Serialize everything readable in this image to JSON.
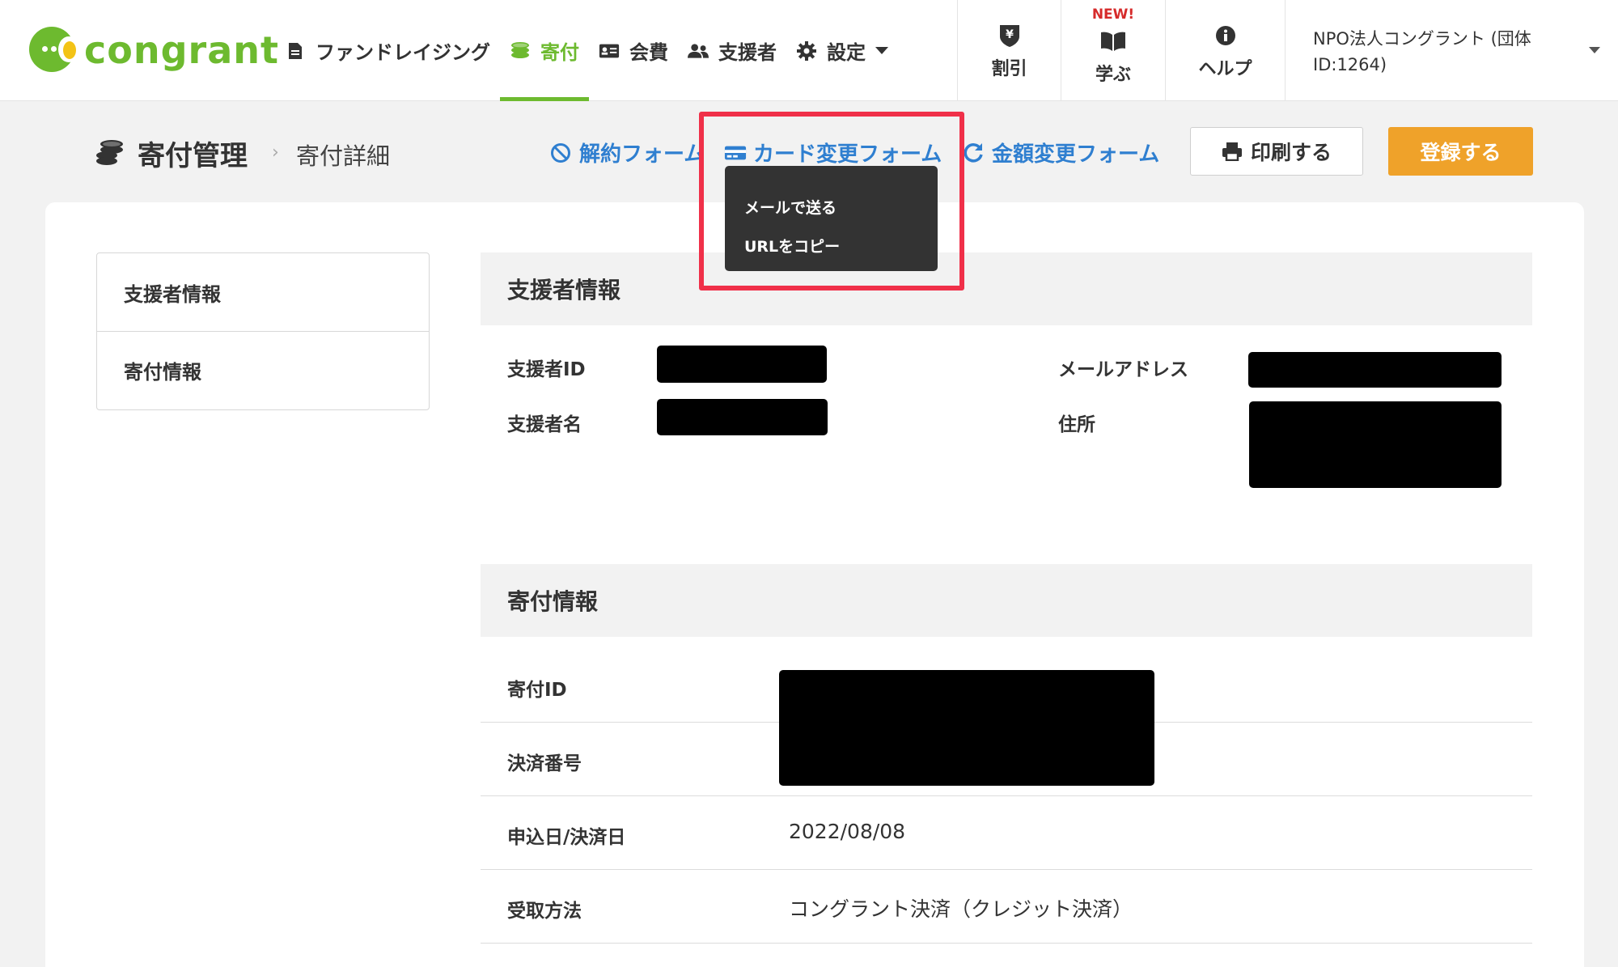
{
  "header": {
    "logo_text": "congrant",
    "nav": [
      {
        "label": "ファンドレイジング",
        "icon": "document-icon"
      },
      {
        "label": "寄付",
        "icon": "coins-icon",
        "active": true
      },
      {
        "label": "会費",
        "icon": "id-card-icon"
      },
      {
        "label": "支援者",
        "icon": "users-icon"
      },
      {
        "label": "設定",
        "icon": "gear-icon"
      }
    ],
    "util": {
      "discount_label": "割引",
      "learn_label": "学ぶ",
      "learn_badge": "NEW!",
      "help_label": "ヘルプ"
    },
    "org_line1": "NPO法人コングラント (団体",
    "org_line2": "ID:1264)"
  },
  "subheader": {
    "title": "寄付管理",
    "breadcrumb_sep": "›",
    "breadcrumb": "寄付詳細",
    "cancel_form": "解約フォーム",
    "card_change_form": "カード変更フォーム",
    "amount_change_form": "金額変更フォーム",
    "print_button": "印刷する",
    "register_button": "登録する"
  },
  "dropdown": {
    "items": [
      "メールで送る",
      "URLをコピー"
    ]
  },
  "sidemenu": {
    "items": [
      "支援者情報",
      "寄付情報"
    ]
  },
  "supporter_section": {
    "title": "支援者情報",
    "id_label": "支援者ID",
    "name_label": "支援者名",
    "email_label": "メールアドレス",
    "address_label": "住所"
  },
  "donation_section": {
    "title": "寄付情報",
    "donation_id_label": "寄付ID",
    "payment_number_label": "決済番号",
    "date_label": "申込日/決済日",
    "date_value": "2022/08/08",
    "method_label": "受取方法",
    "method_value": "コングラント決済（クレジット決済）"
  },
  "colors": {
    "brand_green": "#6dba2f",
    "link_blue": "#2f7fd0",
    "register_orange": "#efa22a",
    "highlight_red": "#f03049"
  }
}
